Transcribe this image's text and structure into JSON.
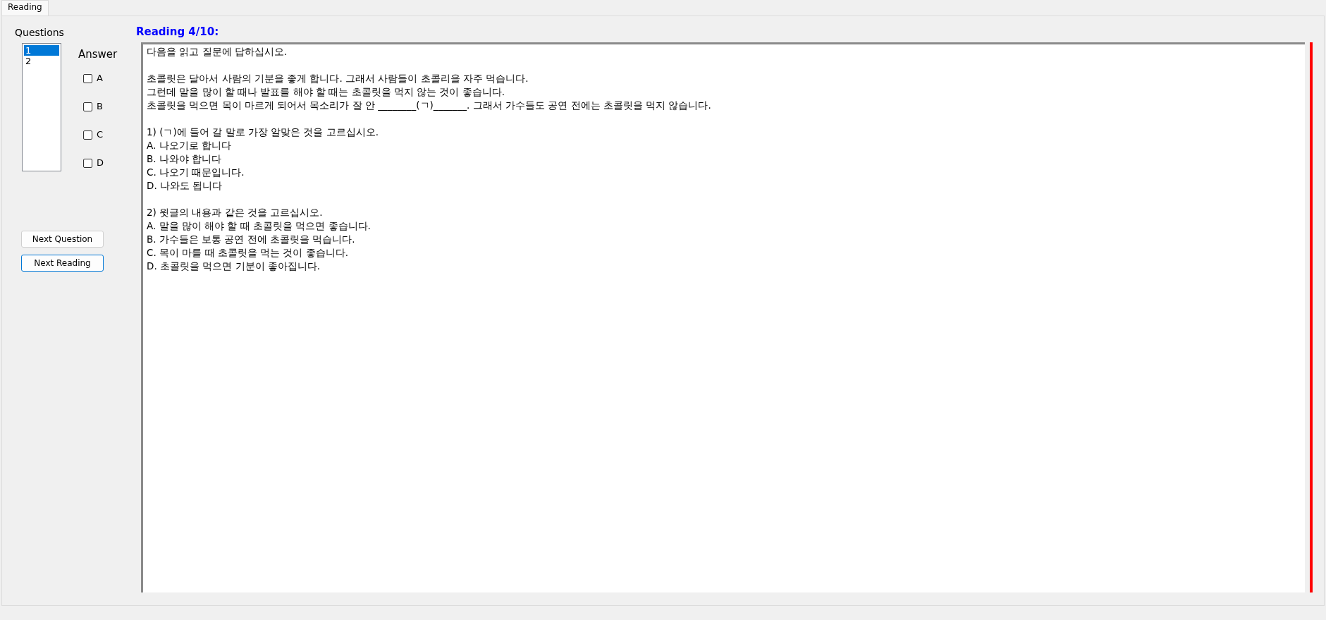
{
  "tabs": [
    {
      "label": "Reading",
      "selected": true
    }
  ],
  "questions": {
    "label": "Questions",
    "items": [
      {
        "label": "1",
        "selected": true
      },
      {
        "label": "2",
        "selected": false
      }
    ]
  },
  "answer": {
    "label": "Answer",
    "options": [
      {
        "label": "A",
        "checked": false
      },
      {
        "label": "B",
        "checked": false
      },
      {
        "label": "C",
        "checked": false
      },
      {
        "label": "D",
        "checked": false
      }
    ]
  },
  "buttons": [
    {
      "label": "Next Question",
      "focused": false
    },
    {
      "label": "Next Reading",
      "focused": true
    }
  ],
  "reading_title": "Reading 4/10:",
  "passage": [
    [
      "다음을 읽고 질문에 답하십시오."
    ],
    [
      "초콜릿은 달아서 사람의 기분을 좋게 합니다. 그래서 사람들이 초콜리을 자주 먹습니다.",
      "그런데 말을 많이 할 때나 발표를 해야 할 때는 초콜릿을 먹지 않는 것이 좋습니다.",
      "초콜릿을 먹으면 목이 마르게 되어서 목소리가 잘 안 ________(ㄱ)_______. 그래서 가수들도 공연 전에는 초콜릿을 먹지 않습니다."
    ],
    [
      "1) (ㄱ)에 들어 갈 말로 가장 알맞은 것을 고르십시오.",
      "A.  나오기로 합니다",
      "B.  나와야 합니다",
      "C.  나오기 때문입니다.",
      "D.  나와도 됩니다"
    ],
    [
      "2) 윗글의 내용과 같은 것을 고르십시오.",
      "A.  말을 많이 해야 할 때 초콜릿을 먹으면 좋습니다.",
      "B.  가수들은 보통 공연 전에 초콜릿을 먹습니다.",
      "C.  목이 마를 때 초콜릿을 먹는 것이 좋습니다.",
      "D.  초콜릿을 먹으면 기분이 좋아집니다."
    ]
  ]
}
